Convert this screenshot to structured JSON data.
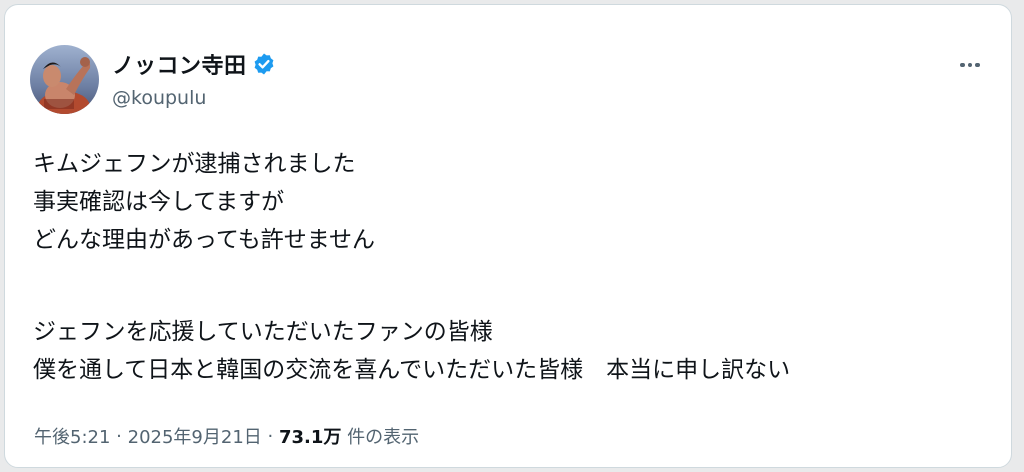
{
  "tweet": {
    "display_name": "ノッコン寺田",
    "handle": "@koupulu",
    "verified": true,
    "lines": [
      "キムジェフンが逮捕されました",
      "事実確認は今してますが",
      "どんな理由があっても許せません",
      "ジェフンを応援していただいたファンの皆様",
      "僕を通して日本と韓国の交流を喜んでいただいた皆様　本当に申し訳ない"
    ],
    "meta": {
      "time": "午後5:21",
      "separator": "·",
      "date": "2025年9月21日",
      "views_count": "73.1万",
      "views_label": "件の表示"
    }
  },
  "colors": {
    "text": "#0f1419",
    "secondary": "#536471",
    "verified_badge": "#1d9bf0",
    "border": "#cfd9de"
  },
  "icons": {
    "verified": "verified-badge-icon",
    "more": "more-options-icon"
  }
}
